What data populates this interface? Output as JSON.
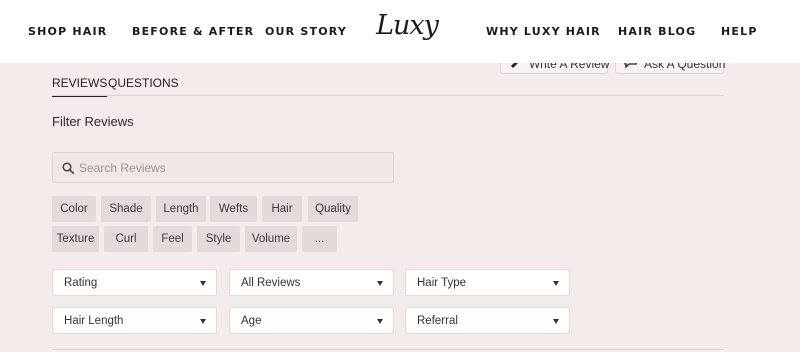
{
  "nav": {
    "shop_hair": "SHOP HAIR",
    "before_after": "BEFORE & AFTER",
    "our_story": "OUR STORY",
    "logo": "Luxy",
    "why_luxy": "WHY LUXY HAIR",
    "hair_blog": "HAIR BLOG",
    "help": "HELP"
  },
  "actions": {
    "write_review": "Write A Review",
    "ask_question": "Ask A Question"
  },
  "tabs": {
    "reviews": "REVIEWS",
    "questions": "QUESTIONS"
  },
  "filter_title": "Filter Reviews",
  "search": {
    "placeholder": "Search Reviews"
  },
  "chips": [
    "Color",
    "Shade",
    "Length",
    "Wefts",
    "Hair",
    "Quality",
    "Texture",
    "Curl",
    "Feel",
    "Style",
    "Volume",
    "..."
  ],
  "dropdowns": [
    "Rating",
    "All Reviews",
    "Hair Type",
    "Hair Length",
    "Age",
    "Referral"
  ],
  "colors": {
    "page_bg": "#f4ecea",
    "chip_bg": "#e3dbd9",
    "text": "#333333"
  }
}
